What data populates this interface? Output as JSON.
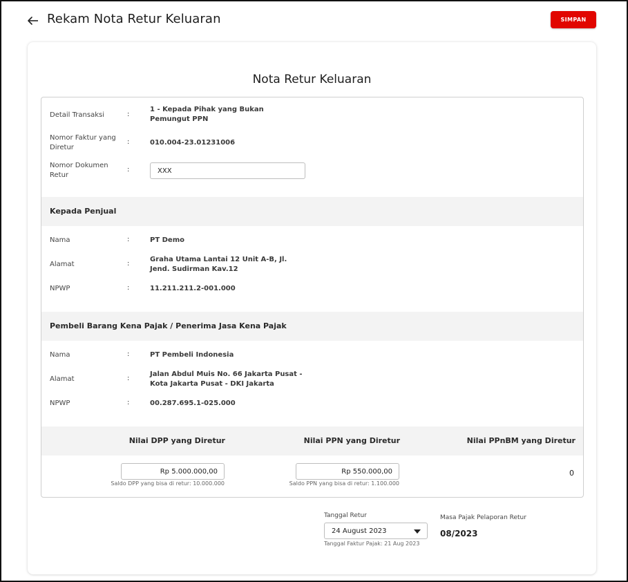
{
  "header": {
    "title": "Rekam Nota Retur Keluaran",
    "save_label": "SIMPAN",
    "accent_color": "#e10600"
  },
  "card": {
    "title": "Nota Retur Keluaran"
  },
  "transaction": {
    "detail_label": "Detail Transaksi",
    "detail_value": "1 - Kepada Pihak yang Bukan Pemungut PPN",
    "faktur_label": "Nomor Faktur yang Diretur",
    "faktur_value": "010.004-23.01231006",
    "doc_label": "Nomor Dokumen Retur",
    "doc_value": "XXX"
  },
  "seller": {
    "section_title": "Kepada Penjual",
    "nama_label": "Nama",
    "nama_value": "PT Demo",
    "alamat_label": "Alamat",
    "alamat_value": "Graha Utama Lantai 12 Unit A-B, Jl. Jend. Sudirman Kav.12",
    "npwp_label": "NPWP",
    "npwp_value": "11.211.211.2-001.000"
  },
  "buyer": {
    "section_title": "Pembeli Barang Kena Pajak / Penerima Jasa Kena Pajak",
    "nama_label": "Nama",
    "nama_value": "PT Pembeli Indonesia",
    "alamat_label": "Alamat",
    "alamat_value": "Jalan Abdul Muis No. 66 Jakarta Pusat - Kota Jakarta Pusat - DKI Jakarta",
    "npwp_label": "NPWP",
    "npwp_value": "00.287.695.1-025.000"
  },
  "values": {
    "dpp_header": "Nilai DPP yang Diretur",
    "ppn_header": "Nilai PPN yang Diretur",
    "ppnbm_header": "Nilai PPnBM yang Diretur",
    "dpp_value": "Rp 5.000.000,00",
    "ppn_value": "Rp 550.000,00",
    "ppnbm_value": "0",
    "dpp_hint": "Saldo DPP yang bisa di retur: 10.000.000",
    "ppn_hint": "Saldo PPN yang bisa di retur: 1.100.000"
  },
  "retur": {
    "tanggal_label": "Tanggal Retur",
    "tanggal_value": "24 August 2023",
    "faktur_date_hint": "Tanggal Faktur Pajak: 21 Aug 2023",
    "masa_label": "Masa Pajak Pelaporan Retur",
    "masa_value": "08/2023"
  },
  "colon": ":"
}
